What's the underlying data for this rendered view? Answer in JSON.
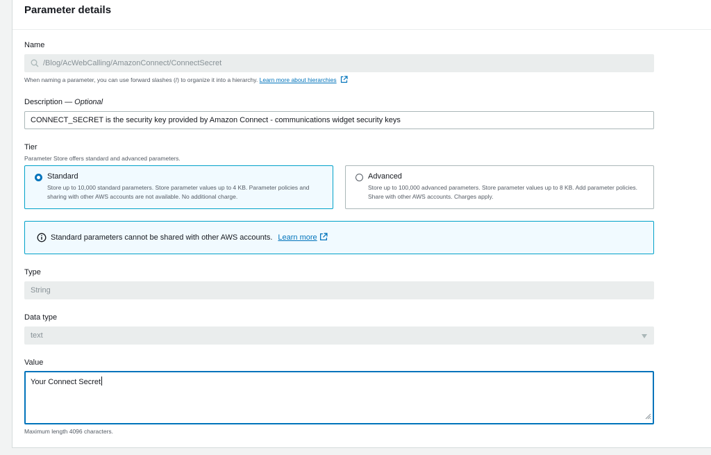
{
  "panel": {
    "title": "Parameter details"
  },
  "name": {
    "label": "Name",
    "value": "/Blog/AcWebCalling/AmazonConnect/ConnectSecret",
    "hint": "When naming a parameter, you can use forward slashes (/) to organize it into a hierarchy.",
    "hint_link": "Learn more about hierarchies"
  },
  "description": {
    "label": "Description — ",
    "label_optional": "Optional",
    "value": "CONNECT_SECRET is the security key provided by Amazon Connect - communications widget security keys"
  },
  "tier": {
    "label": "Tier",
    "hint": "Parameter Store offers standard and advanced parameters.",
    "options": [
      {
        "title": "Standard",
        "description": "Store up to 10,000 standard parameters. Store parameter values up to 4 KB. Parameter policies and sharing with other AWS accounts are not available. No additional charge.",
        "selected": true
      },
      {
        "title": "Advanced",
        "description": "Store up to 100,000 advanced parameters. Store parameter values up to 8 KB. Add parameter policies. Share with other AWS accounts. Charges apply.",
        "selected": false
      }
    ]
  },
  "info": {
    "text": "Standard parameters cannot be shared with other AWS accounts.",
    "link": "Learn more"
  },
  "type": {
    "label": "Type",
    "value": "String"
  },
  "data_type": {
    "label": "Data type",
    "value": "text"
  },
  "value": {
    "label": "Value",
    "text": "Your Connect Secret",
    "hint": "Maximum length 4096 characters."
  },
  "colors": {
    "accent": "#0073bb",
    "selected_border": "#00a1c9",
    "selected_bg": "#f1faff",
    "disabled_bg": "#eaeded"
  },
  "icons": {
    "search": "search-icon",
    "external_link": "external-link-icon",
    "info": "info-icon",
    "dropdown": "caret-down-icon"
  }
}
